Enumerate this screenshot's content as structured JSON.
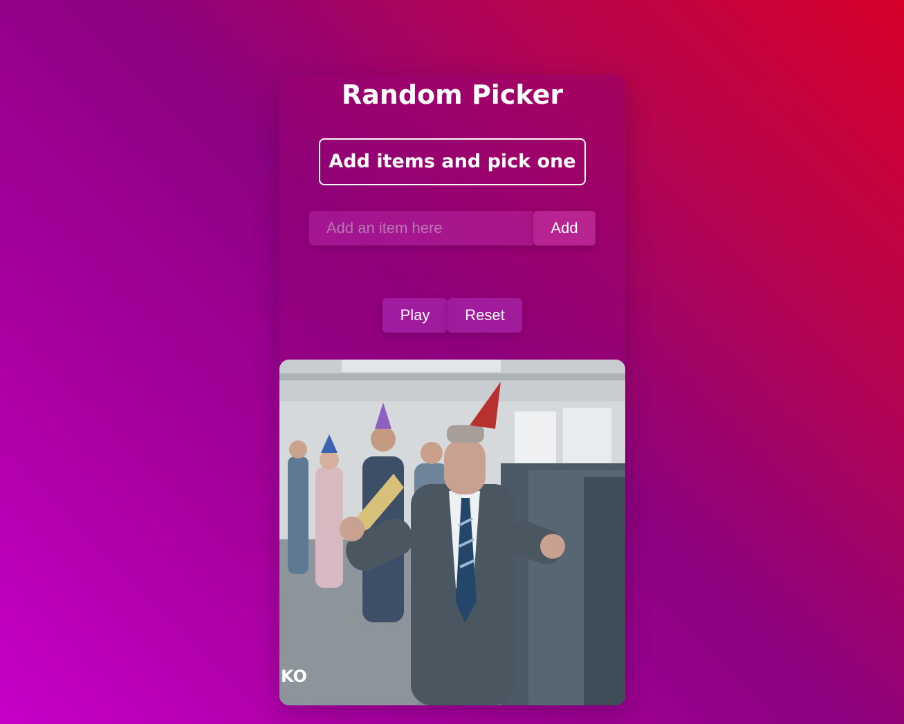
{
  "app": {
    "title": "Random Picker",
    "subtitle": "Add items and pick one"
  },
  "input": {
    "placeholder": "Add an item here",
    "value": ""
  },
  "buttons": {
    "add": "Add",
    "play": "Play",
    "reset": "Reset"
  },
  "gif": {
    "description": "office-party-dancing-gif",
    "watermark": "KO"
  },
  "colors": {
    "accent": "#c600c8",
    "background_top_right": "#d6002a",
    "text": "#ffffff"
  }
}
